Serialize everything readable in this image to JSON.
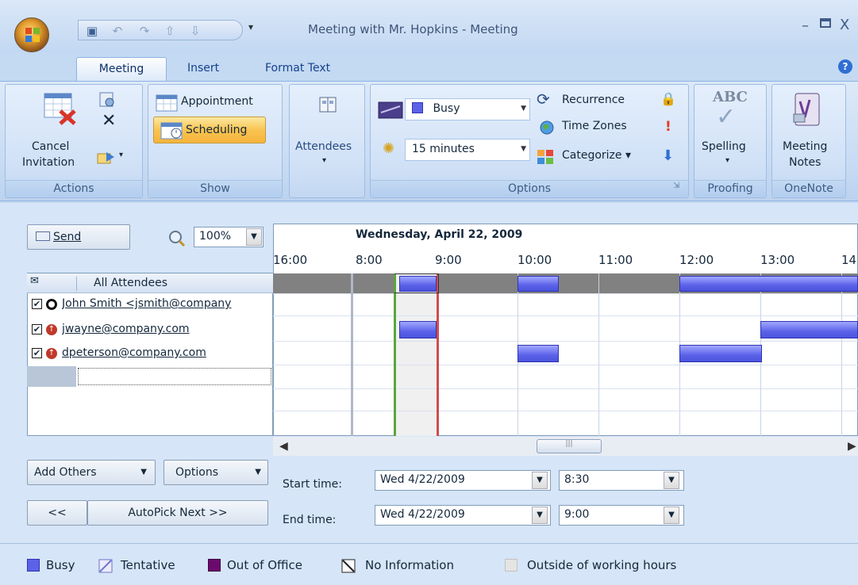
{
  "window": {
    "title": "Meeting with Mr. Hopkins - Meeting",
    "minimize": "–",
    "close": "X"
  },
  "quick_access": {
    "icons": [
      "save-icon",
      "undo-icon",
      "redo-icon",
      "up-icon",
      "down-icon"
    ],
    "dropdown": "▾"
  },
  "tabs": [
    "Meeting",
    "Insert",
    "Format Text"
  ],
  "help": "?",
  "ribbon": {
    "actions": {
      "label": "Actions",
      "cancel_line1": "Cancel",
      "cancel_line2": "Invitation"
    },
    "show": {
      "label": "Show",
      "appointment": "Appointment",
      "scheduling": "Scheduling"
    },
    "attendees": {
      "label": "Attendees"
    },
    "options": {
      "label": "Options",
      "show_as": "Busy",
      "reminder": "15 minutes",
      "recurrence": "Recurrence",
      "time_zones": "Time Zones",
      "categorize": "Categorize ▾"
    },
    "proofing": {
      "label": "Proofing",
      "spelling": "Spelling",
      "abc": "ABC"
    },
    "onenote": {
      "label": "OneNote",
      "notes_line1": "Meeting",
      "notes_line2": "Notes"
    }
  },
  "scheduling": {
    "send": "Send",
    "zoom": "100%",
    "date_header": "Wednesday, April 22, 2009",
    "hours": [
      "16:00",
      "8:00",
      "9:00",
      "10:00",
      "11:00",
      "12:00",
      "13:00",
      "14"
    ],
    "all_attendees": "All Attendees",
    "attendees": [
      {
        "name": "John Smith <jsmith@company",
        "checked": "✔",
        "role": "organizer"
      },
      {
        "name": "jwayne@company.com",
        "checked": "✔",
        "role": "required"
      },
      {
        "name": "dpeterson@company.com",
        "checked": "✔",
        "role": "required"
      }
    ],
    "add_others": "Add Others",
    "options": "Options",
    "prev": "<<",
    "autopick": "AutoPick Next >>",
    "start_label": "Start time:",
    "start_date": "Wed 4/22/2009",
    "start_time": "8:30",
    "end_label": "End time:",
    "end_date": "Wed 4/22/2009",
    "end_time": "9:00"
  },
  "legend": {
    "busy": "Busy",
    "tentative": "Tentative",
    "out_of_office": "Out of Office",
    "no_info": "No Information",
    "outside_hours": "Outside of working hours"
  },
  "colors": {
    "busy": "#5b62e8",
    "out_of_office": "#6b0a6e",
    "accent_start": "#5aa63e",
    "accent_end": "#d64a4a"
  }
}
